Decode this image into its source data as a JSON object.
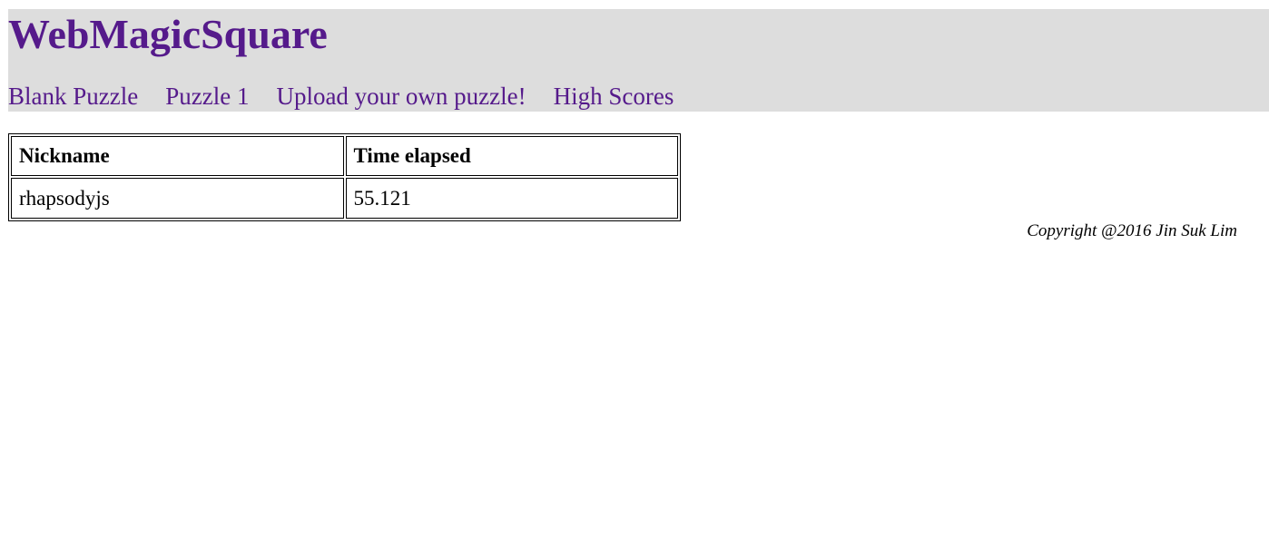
{
  "site": {
    "title": "WebMagicSquare"
  },
  "nav": {
    "items": [
      {
        "label": "Blank Puzzle"
      },
      {
        "label": "Puzzle 1"
      },
      {
        "label": "Upload your own puzzle!"
      },
      {
        "label": "High Scores"
      }
    ]
  },
  "scores": {
    "headers": [
      "Nickname",
      "Time elapsed"
    ],
    "rows": [
      [
        "rhapsodyjs",
        "55.121"
      ]
    ]
  },
  "footer": {
    "copyright": "Copyright @2016 Jin Suk Lim"
  },
  "colors": {
    "link": "#551a8b",
    "header_background": "#dddddd"
  }
}
